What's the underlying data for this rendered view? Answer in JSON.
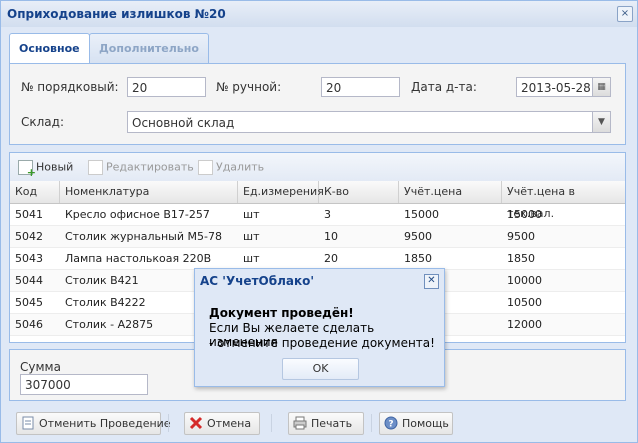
{
  "window": {
    "title": "Оприходование излишков №20",
    "close_icon": "×"
  },
  "tabs": [
    {
      "label": "Основное",
      "active": true
    },
    {
      "label": "Дополнительно",
      "active": false
    }
  ],
  "form": {
    "order_no_label": "№ порядковый:",
    "order_no_value": "20",
    "manual_no_label": "№ ручной:",
    "manual_no_value": "20",
    "date_label": "Дата д-та:",
    "date_value": "2013-05-28",
    "warehouse_label": "Склад:",
    "warehouse_value": "Основной склад"
  },
  "grid_toolbar": {
    "new_label": "Новый",
    "edit_label": "Редактировать",
    "delete_label": "Удалить"
  },
  "grid": {
    "columns": [
      "Код",
      "Номенклатура",
      "Ед.измерения",
      "К-во",
      "Учёт.цена",
      "Учёт.цена в тек.вал."
    ],
    "rows": [
      [
        "5041",
        "Кресло офисное B17-257",
        "шт",
        "3",
        "15000",
        "15000"
      ],
      [
        "5042",
        "Столик журнальный M5-78",
        "шт",
        "10",
        "9500",
        "9500"
      ],
      [
        "5043",
        "Лампа настолькоая 220В",
        "шт",
        "20",
        "1850",
        "1850"
      ],
      [
        "5044",
        "Столик B421",
        "",
        "",
        "",
        "10000"
      ],
      [
        "5045",
        "Столик B4222",
        "",
        "",
        "",
        "10500"
      ],
      [
        "5046",
        "Столик - A2875",
        "",
        "",
        "",
        "12000"
      ]
    ]
  },
  "summary": {
    "label": "Сумма",
    "value": "307000"
  },
  "bottom_buttons": {
    "cancel_posting": "Отменить Проведение",
    "cancel": "Отмена",
    "print": "Печать",
    "help": "Помощь"
  },
  "dialog": {
    "title": "АС 'УчетОблако'",
    "heading": "Документ проведён!",
    "line1": "Если Вы желаете сделать изменения",
    "line2": "- отмените проведение документа!",
    "ok_label": "OK"
  },
  "colors": {
    "accent": "#15428b",
    "border": "#99bbe8",
    "panel_bg": "#dfe8f6"
  }
}
